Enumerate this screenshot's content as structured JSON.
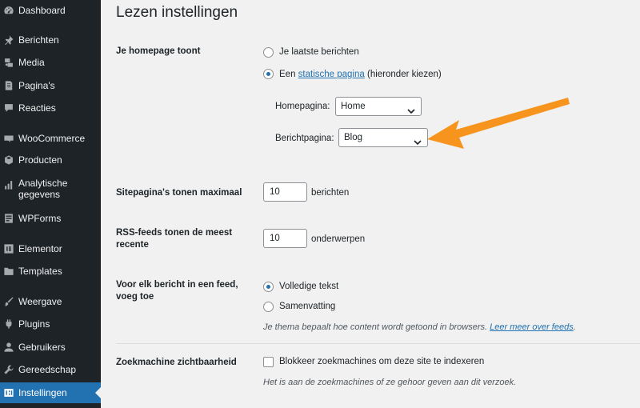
{
  "sidebar": {
    "items": [
      {
        "label": "Dashboard",
        "icon": "dashboard-icon"
      },
      {
        "label": "Berichten",
        "icon": "pin-icon"
      },
      {
        "label": "Media",
        "icon": "media-icon"
      },
      {
        "label": "Pagina's",
        "icon": "page-icon"
      },
      {
        "label": "Reacties",
        "icon": "comment-icon"
      },
      {
        "label": "WooCommerce",
        "icon": "woocommerce-icon"
      },
      {
        "label": "Producten",
        "icon": "box-icon"
      },
      {
        "label": "Analytische gegevens",
        "icon": "bar-chart-icon"
      },
      {
        "label": "WPForms",
        "icon": "form-icon"
      },
      {
        "label": "Elementor",
        "icon": "elementor-icon"
      },
      {
        "label": "Templates",
        "icon": "folder-icon"
      },
      {
        "label": "Weergave",
        "icon": "brush-icon"
      },
      {
        "label": "Plugins",
        "icon": "plug-icon"
      },
      {
        "label": "Gebruikers",
        "icon": "user-icon"
      },
      {
        "label": "Gereedschap",
        "icon": "wrench-icon"
      },
      {
        "label": "Instellingen",
        "icon": "settings-icon",
        "active": true
      }
    ]
  },
  "page": {
    "title": "Lezen instellingen"
  },
  "homepage_setting": {
    "label": "Je homepage toont",
    "option_latest": "Je laatste berichten",
    "option_static_prefix": "Een",
    "option_static_link": "statische pagina",
    "option_static_suffix": "(hieronder kiezen)",
    "selected": "static",
    "homepage_label": "Homepagina:",
    "homepage_value": "Home",
    "postspage_label": "Berichtpagina:",
    "postspage_value": "Blog"
  },
  "posts_per_page": {
    "label": "Sitepagina's tonen maximaal",
    "value": "10",
    "unit": "berichten"
  },
  "rss_posts": {
    "label": "RSS-feeds tonen de meest recente",
    "value": "10",
    "unit": "onderwerpen"
  },
  "feed_content": {
    "label": "Voor elk bericht in een feed, voeg toe",
    "option_full": "Volledige tekst",
    "option_summary": "Samenvatting",
    "selected": "full",
    "description": "Je thema bepaalt hoe content wordt getoond in browsers.",
    "description_link": "Leer meer over feeds"
  },
  "search_visibility": {
    "label": "Zoekmachine zichtbaarheid",
    "checkbox_label": "Blokkeer zoekmachines om deze site te indexeren",
    "checked": false,
    "description": "Het is aan de zoekmachines of ze gehoor geven aan dit verzoek."
  },
  "colors": {
    "sidebar_bg": "#1d2327",
    "active_bg": "#2271b1",
    "link": "#2271b1",
    "annotation_arrow": "#f7941d"
  }
}
